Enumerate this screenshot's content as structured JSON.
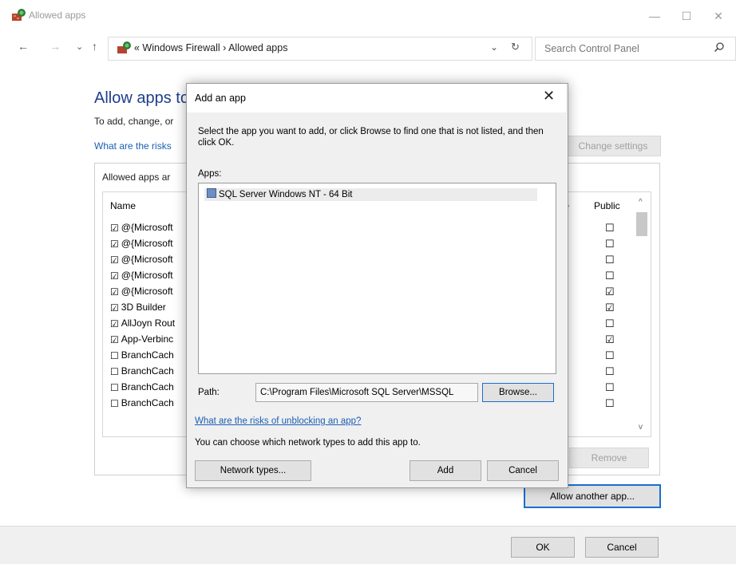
{
  "window": {
    "title": "Allowed apps",
    "minimize": "—",
    "maximize": "☐",
    "close": "✕"
  },
  "nav": {
    "back": "←",
    "forward": "→",
    "recent": "⌄",
    "up": "↑",
    "breadcrumb": "« Windows Firewall › Allowed apps",
    "dropdown": "⌄",
    "refresh": "↻",
    "search_placeholder": "Search Control Panel"
  },
  "main": {
    "heading": "Allow apps to",
    "description": "To add, change, or",
    "risk_link": "What are the risks",
    "change_settings": "Change settings",
    "group_label": "Allowed apps ar",
    "columns": {
      "name": "Name",
      "private": "te",
      "public": "Public"
    },
    "rows": [
      {
        "name": "@{Microsoft",
        "checked": "☑",
        "public": "☐"
      },
      {
        "name": "@{Microsoft",
        "checked": "☑",
        "public": "☐"
      },
      {
        "name": "@{Microsoft",
        "checked": "☑",
        "public": "☐"
      },
      {
        "name": "@{Microsoft",
        "checked": "☑",
        "public": "☐"
      },
      {
        "name": "@{Microsoft",
        "checked": "☑",
        "public": "☑"
      },
      {
        "name": "3D Builder",
        "checked": "☑",
        "public": "☑"
      },
      {
        "name": "AllJoyn Rout",
        "checked": "☑",
        "public": "☐"
      },
      {
        "name": "App-Verbinc",
        "checked": "☑",
        "public": "☑"
      },
      {
        "name": "BranchCach",
        "checked": "☐",
        "public": "☐"
      },
      {
        "name": "BranchCach",
        "checked": "☐",
        "public": "☐"
      },
      {
        "name": "BranchCach",
        "checked": "☐",
        "public": "☐"
      },
      {
        "name": "BranchCach",
        "checked": "☐",
        "public": "☐"
      }
    ],
    "remove": "Remove",
    "allow_another": "Allow another app...",
    "ok": "OK",
    "cancel": "Cancel"
  },
  "dialog": {
    "title": "Add an app",
    "close": "✕",
    "description": "Select the app you want to add, or click Browse to find one that is not listed, and then click OK.",
    "apps_label": "Apps:",
    "apps": [
      "SQL Server Windows NT - 64 Bit"
    ],
    "path_label": "Path:",
    "path_value": "C:\\Program Files\\Microsoft SQL Server\\MSSQL",
    "browse": "Browse...",
    "risk_link": "What are the risks of unblocking an app?",
    "network_text": "You can choose which network types to add this app to.",
    "network_types": "Network types...",
    "add": "Add",
    "cancel": "Cancel"
  },
  "colors": {
    "accent": "#1a6fd0",
    "heading": "#1e3e8c",
    "link": "#1a5fb4"
  }
}
